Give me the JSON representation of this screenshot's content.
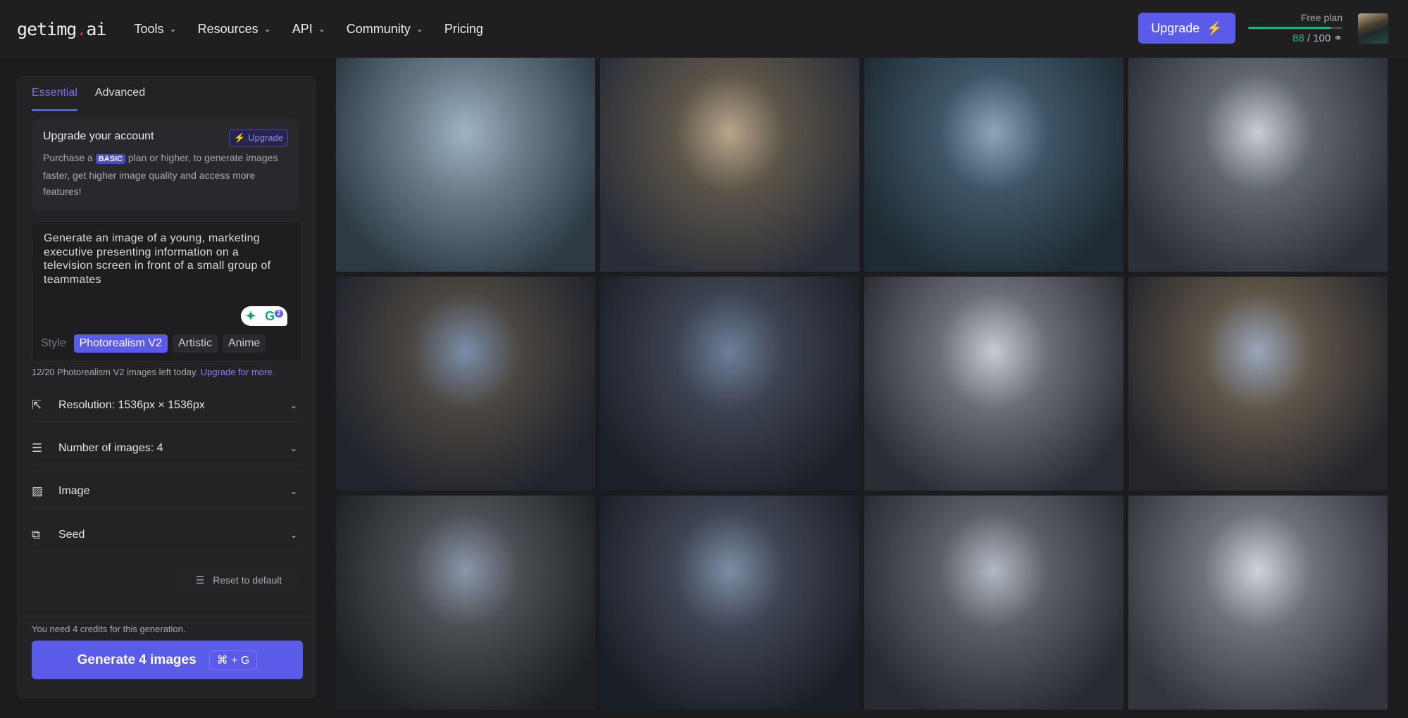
{
  "header": {
    "logo": "getimg",
    "logo_dot": ".",
    "logo_suffix": "ai",
    "nav": [
      {
        "label": "Tools",
        "dropdown": true
      },
      {
        "label": "Resources",
        "dropdown": true
      },
      {
        "label": "API",
        "dropdown": true
      },
      {
        "label": "Community",
        "dropdown": true
      },
      {
        "label": "Pricing",
        "dropdown": false
      }
    ],
    "upgrade_label": "Upgrade",
    "plan_label": "Free plan",
    "credits_used": "88",
    "credits_total": "/ 100",
    "credits_fraction": 0.88,
    "accent": "#5b5bea"
  },
  "sidebar": {
    "tabs": [
      {
        "label": "Essential",
        "active": true
      },
      {
        "label": "Advanced",
        "active": false
      }
    ],
    "upgrade_card": {
      "title": "Upgrade your account",
      "button": "Upgrade",
      "text_before": "Purchase a",
      "badge": "BASIC",
      "text_after": "plan or higher, to generate images faster, get higher image quality and access more features!"
    },
    "prompt": "Generate an image of a young, marketing executive presenting information on a television screen in front of a small group of teammates",
    "grammarly_count": "2",
    "style_label": "Style",
    "styles": [
      {
        "label": "Photorealism V2",
        "active": true
      },
      {
        "label": "Artistic",
        "active": false
      },
      {
        "label": "Anime",
        "active": false
      }
    ],
    "quota_text": "12/20 Photorealism V2 images left today.",
    "quota_link": "Upgrade for more.",
    "settings": [
      {
        "icon": "resize-icon",
        "label": "Resolution: 1536px × 1536px"
      },
      {
        "icon": "sliders-icon",
        "label": "Number of images: 4"
      },
      {
        "icon": "image-icon",
        "label": "Image"
      },
      {
        "icon": "seed-icon",
        "label": "Seed"
      }
    ],
    "reset_label": "Reset to default",
    "credits_note": "You need 4 credits for this generation.",
    "generate_label": "Generate 4 images",
    "shortcut": "⌘ + G"
  },
  "gallery": {
    "count": 12
  }
}
